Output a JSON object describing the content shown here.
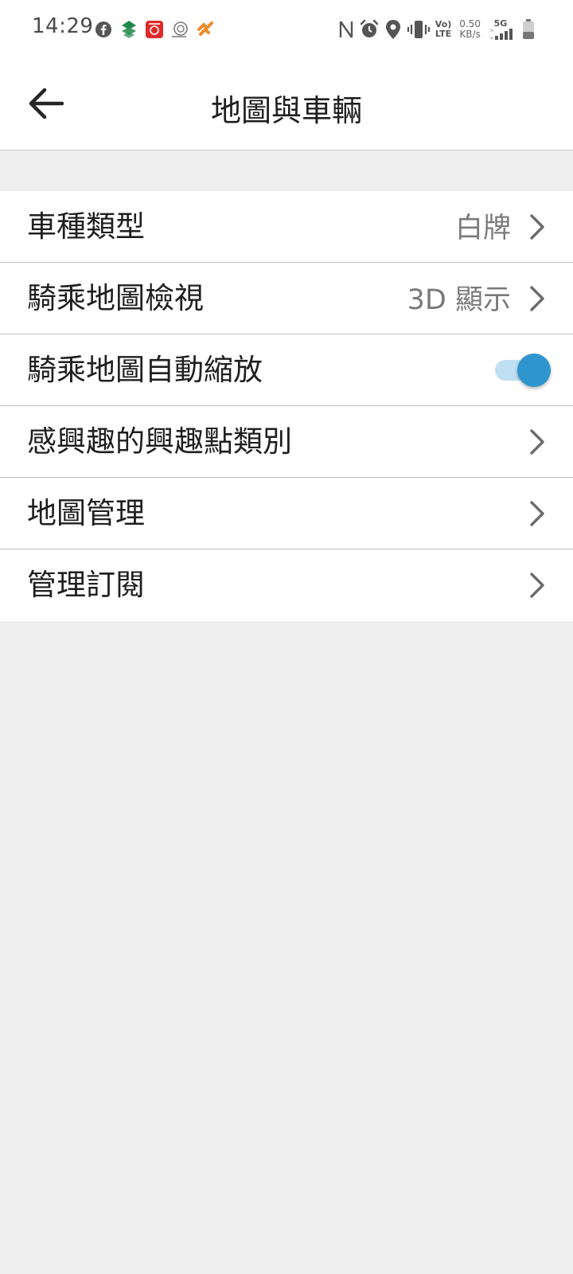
{
  "status_bar": {
    "time": "14:29",
    "volte": "Vo)",
    "lte": "LTE",
    "speed_value": "0.50",
    "speed_unit": "KB/s",
    "network": "5G",
    "left_icons": [
      "facebook-icon",
      "leaf-app-icon",
      "red-app-icon",
      "circle-app-icon",
      "orange-app-icon"
    ],
    "right_icons": [
      "nfc-icon",
      "alarm-icon",
      "location-icon",
      "vibrate-icon",
      "signal-icon",
      "battery-icon"
    ]
  },
  "app_bar": {
    "title": "地圖與車輛",
    "back_icon": "arrow-left-icon"
  },
  "settings": {
    "vehicle_type": {
      "label": "車種類型",
      "value": "白牌"
    },
    "map_view": {
      "label": "騎乘地圖檢視",
      "value": "3D 顯示"
    },
    "auto_zoom": {
      "label": "騎乘地圖自動縮放",
      "enabled": true
    },
    "poi_categories": {
      "label": "感興趣的興趣點類別"
    },
    "map_management": {
      "label": "地圖管理"
    },
    "subscriptions": {
      "label": "管理訂閱"
    }
  },
  "colors": {
    "accent": "#2f95cf",
    "accent_track": "#bfe0f2",
    "background": "#efefef",
    "surface": "#ffffff"
  }
}
